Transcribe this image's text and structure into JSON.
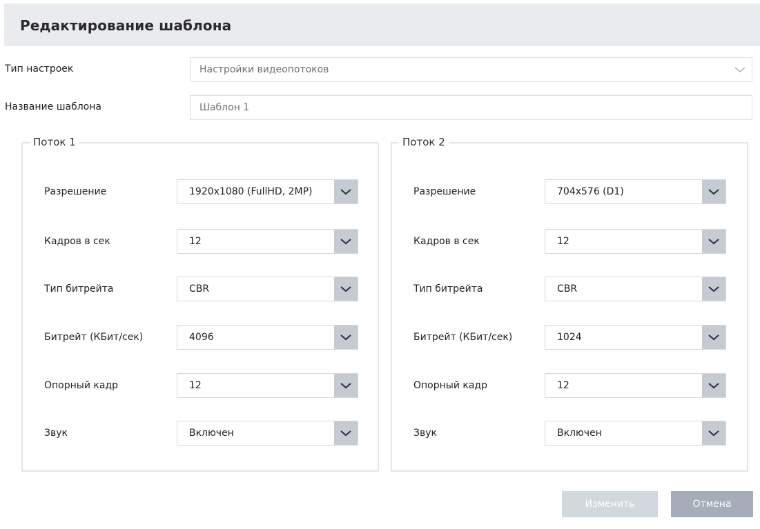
{
  "dialog": {
    "title": "Редактирование шаблона"
  },
  "settings_type": {
    "label": "Тип настроек",
    "value": "Настройки видеопотоков"
  },
  "template_name": {
    "label": "Название шаблона",
    "value": "Шаблон 1"
  },
  "streams": [
    {
      "title": "Поток 1",
      "fields": [
        {
          "label": "Разрешение",
          "value": "1920x1080 (FullHD, 2MP)"
        },
        {
          "label": "Кадров в сек",
          "value": "12"
        },
        {
          "label": "Тип битрейта",
          "value": "CBR"
        },
        {
          "label": "Битрейт (КБит/сек)",
          "value": "4096"
        },
        {
          "label": "Опорный кадр",
          "value": "12"
        },
        {
          "label": "Звук",
          "value": "Включен"
        }
      ]
    },
    {
      "title": "Поток 2",
      "fields": [
        {
          "label": "Разрешение",
          "value": "704x576 (D1)"
        },
        {
          "label": "Кадров в сек",
          "value": "12"
        },
        {
          "label": "Тип битрейта",
          "value": "CBR"
        },
        {
          "label": "Битрейт (КБит/сек)",
          "value": "1024"
        },
        {
          "label": "Опорный кадр",
          "value": "12"
        },
        {
          "label": "Звук",
          "value": "Включен"
        }
      ]
    }
  ],
  "buttons": {
    "apply": "Изменить",
    "cancel": "Отмена"
  },
  "colors": {
    "header_bg": "#e9ebef",
    "apply_disabled_bg": "#d3d7de",
    "cancel_bg": "#a5adb9"
  },
  "icons": {
    "dropdown": "chevron-down-icon"
  }
}
